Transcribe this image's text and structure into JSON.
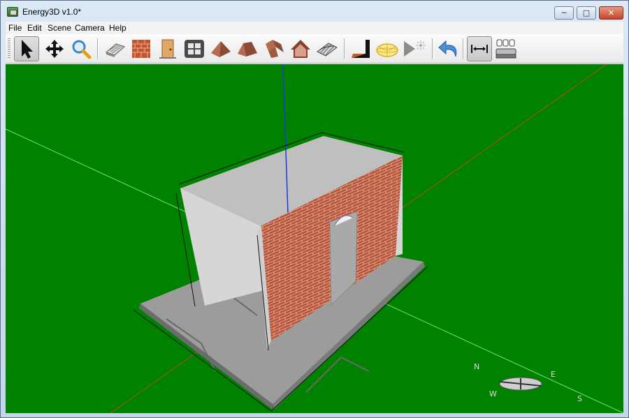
{
  "window": {
    "title": "Energy3D v1.0*",
    "minimize_label": "─",
    "maximize_label": "□",
    "close_label": "✕"
  },
  "menu": {
    "items": [
      {
        "label": "File"
      },
      {
        "label": "Edit"
      },
      {
        "label": "Scene"
      },
      {
        "label": "Camera"
      },
      {
        "label": "Help"
      }
    ]
  },
  "toolbar": {
    "tools": [
      {
        "name": "select-tool",
        "icon": "arrow-cursor-icon",
        "selected": true
      },
      {
        "name": "move-tool",
        "icon": "move-arrows-icon"
      },
      {
        "name": "zoom-tool",
        "icon": "magnifier-icon"
      },
      {
        "name": "foundation-tool",
        "icon": "foundation-icon"
      },
      {
        "name": "wall-tool",
        "icon": "brick-wall-icon"
      },
      {
        "name": "door-tool",
        "icon": "door-icon"
      },
      {
        "name": "window-tool",
        "icon": "window-icon"
      },
      {
        "name": "pyramid-roof-tool",
        "icon": "pyramid-roof-icon"
      },
      {
        "name": "hip-roof-tool",
        "icon": "hip-roof-icon"
      },
      {
        "name": "custom-roof-tool",
        "icon": "custom-roof-icon"
      },
      {
        "name": "gable-roof-tool",
        "icon": "gable-roof-icon"
      },
      {
        "name": "floor-tool",
        "icon": "floor-grid-icon"
      },
      {
        "name": "sun-path-tool",
        "icon": "sun-path-icon"
      },
      {
        "name": "heliodon-tool",
        "icon": "heliodon-icon"
      },
      {
        "name": "play-sun-tool",
        "icon": "play-sun-icon"
      },
      {
        "name": "undo-tool",
        "icon": "undo-arrow-icon"
      },
      {
        "name": "annotation-tool",
        "icon": "dimension-icon",
        "selected": true
      },
      {
        "name": "preview-tool",
        "icon": "preview-icon"
      }
    ]
  },
  "scene": {
    "ground_color": "#008200",
    "wall_color": "#d6d6d6",
    "brick_color": "#b8543a",
    "door_color": "#a9a9a9",
    "compass": {
      "north": "N",
      "east": "E",
      "south": "S",
      "west": "W"
    }
  }
}
